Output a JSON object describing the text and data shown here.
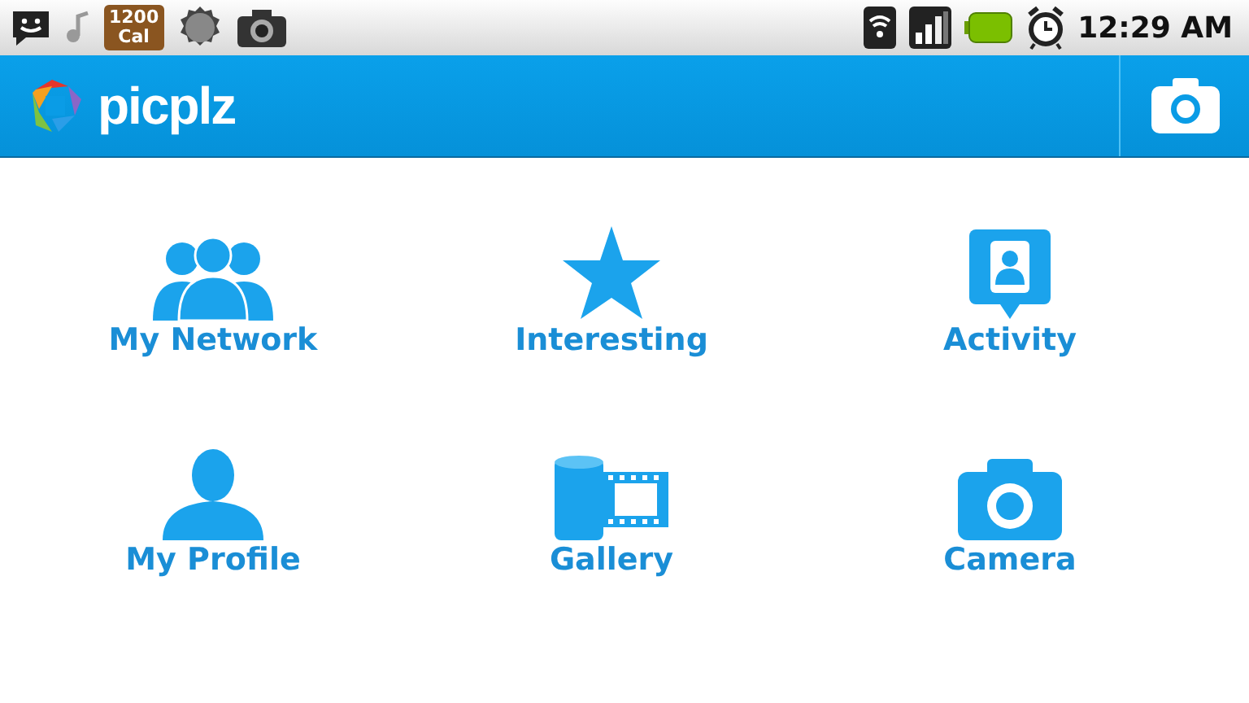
{
  "status_bar": {
    "calorie_badge": [
      "1200",
      "Cal"
    ],
    "time": "12:29 AM"
  },
  "app_bar": {
    "title": "picplz"
  },
  "tiles": [
    {
      "kind": "network",
      "label": "My Network"
    },
    {
      "kind": "interesting",
      "label": "Interesting"
    },
    {
      "kind": "activity",
      "label": "Activity"
    },
    {
      "kind": "profile",
      "label": "My Profile"
    },
    {
      "kind": "gallery",
      "label": "Gallery"
    },
    {
      "kind": "camera",
      "label": "Camera"
    }
  ]
}
